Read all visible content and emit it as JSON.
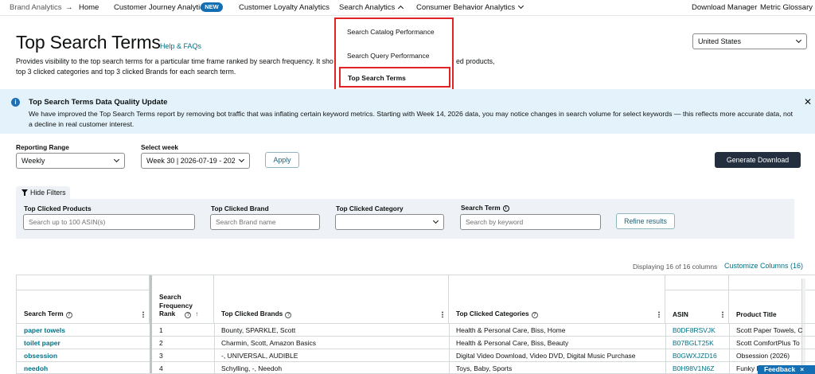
{
  "nav": {
    "brand": "Brand Analytics",
    "arrow": "→",
    "items": [
      "Home",
      "Customer Journey Analytics",
      "Customer Loyalty Analytics",
      "Search Analytics",
      "Consumer Behavior Analytics"
    ],
    "new_badge": "NEW",
    "right": [
      "Download Manager",
      "Metric Glossary"
    ]
  },
  "dropdown": {
    "items": [
      "Search Catalog Performance",
      "Search Query Performance",
      "Top Search Terms"
    ]
  },
  "page": {
    "title": "Top Search Terms",
    "help": "Help & FAQs",
    "desc_line1": "Provides visibility to the top search terms for a particular time frame ranked by search frequency. It sho",
    "desc_line1_tail": "ed products,",
    "desc_line2": "top 3 clicked categories and top 3 clicked Brands for each search term.",
    "marketplace": "United States"
  },
  "banner": {
    "icon": "i",
    "title": "Top Search Terms Data Quality Update",
    "line1": "We have improved the Top Search Terms report by removing bot traffic that was inflating certain keyword metrics. Starting with Week 14, 2026 data, you may notice changes in search volume for select keywords — this reflects more accurate data, not",
    "line2": "a decline in real customer interest.",
    "close": "✕"
  },
  "controls": {
    "reporting_range_label": "Reporting Range",
    "reporting_range_value": "Weekly",
    "select_week_label": "Select week",
    "select_week_value": "Week 30 | 2026-07-19 - 2026",
    "apply": "Apply",
    "generate": "Generate Download"
  },
  "filters": {
    "hide": "Hide Filters",
    "products_label": "Top Clicked Products",
    "products_placeholder": "Search up to 100 ASIN(s)",
    "brand_label": "Top Clicked Brand",
    "brand_placeholder": "Search Brand name",
    "category_label": "Top Clicked Category",
    "term_label": "Search Term",
    "term_placeholder": "Search by keyword",
    "refine": "Refine results"
  },
  "table_meta": {
    "displaying": "Displaying 16 of 16 columns",
    "customize": "Customize Columns (16)"
  },
  "table": {
    "columns": {
      "term": "Search Term",
      "rank_l1": "Search",
      "rank_l2": "Frequency",
      "rank_l3": "Rank",
      "brands": "Top Clicked Brands",
      "categories": "Top Clicked Categories",
      "asin": "ASIN",
      "title": "Product Title"
    },
    "rows": [
      {
        "term": "paper towels",
        "rank": "1",
        "brands": "Bounty, SPARKLE, Scott",
        "categories": "Health & Personal Care, Biss, Home",
        "asin": "B0DF8RSVJK",
        "title": "Scott Paper Towels, C"
      },
      {
        "term": "toilet paper",
        "rank": "2",
        "brands": "Charmin, Scott, Amazon Basics",
        "categories": "Health & Personal Care, Biss, Beauty",
        "asin": "B07BGLT25K",
        "title": "Scott ComfortPlus To"
      },
      {
        "term": "obsession",
        "rank": "3",
        "brands": "-, UNIVERSAL, AUDIBLE",
        "categories": "Digital Video Download, Video DVD, Digital Music Purchase",
        "asin": "B0GWXJZD16",
        "title": "Obsession (2026)"
      },
      {
        "term": "needoh",
        "rank": "4",
        "brands": "Schylling, -, Needoh",
        "categories": "Toys, Baby, Sports",
        "asin": "B0H98V1N6Z",
        "title": "Funky F"
      }
    ]
  },
  "feedback": "Feedback",
  "feedback_close": "×"
}
